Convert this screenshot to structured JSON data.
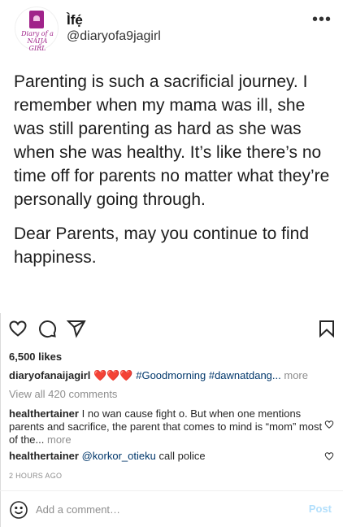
{
  "post_image": {
    "account_name": "Ìfẹ́",
    "account_handle": "@diaryofa9jagirl",
    "logo_text": "Diary of a NAIJA GIRL",
    "more_icon": "more-horizontal-icon",
    "quote_paragraphs": [
      "Parenting is such a sacrificial journey. I remember when my mama was ill, she was still parenting as hard as she was when she was healthy. It’s like there’s no time off for parents no matter what they’re personally going through.",
      "Dear Parents, may you continue to find happiness."
    ]
  },
  "actions": {
    "icons": [
      "heart-icon",
      "comment-icon",
      "share-icon",
      "bookmark-icon"
    ]
  },
  "likes": "6,500 likes",
  "caption": {
    "username": "diaryofanaijagirl",
    "hearts": "❤️❤️❤️",
    "hashtags": "#Goodmorning #dawnatdang...",
    "more": "more"
  },
  "view_all_comments": "View all 420 comments",
  "comments": [
    {
      "username": "healthertainer",
      "text": "I no wan cause fight o. But when one mentions parents and sacrifice, the parent that comes to mind is “mom” most of the...",
      "more": "more"
    },
    {
      "username": "healthertainer",
      "mention": "@korkor_otieku",
      "text": "call police"
    }
  ],
  "timestamp": "2 HOURS AGO",
  "add_comment": {
    "placeholder": "Add a comment…",
    "post_label": "Post"
  },
  "colors": {
    "link": "#00376b",
    "muted": "#8e8e8e",
    "post_disabled": "#b2dffc",
    "logo_brand": "#a0238a"
  }
}
